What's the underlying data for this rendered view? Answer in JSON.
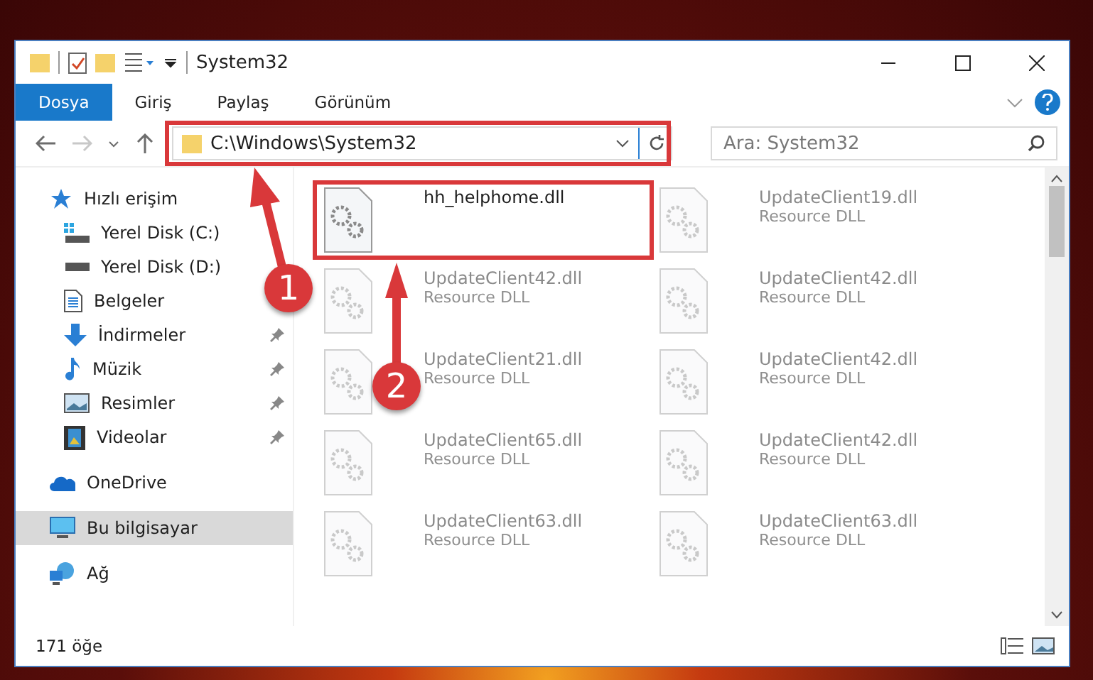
{
  "window": {
    "title": "System32"
  },
  "ribbon_tabs": [
    {
      "label": "Dosya",
      "selected": true
    },
    {
      "label": "Giriş",
      "selected": false
    },
    {
      "label": "Paylaş",
      "selected": false
    },
    {
      "label": "Görünüm",
      "selected": false
    }
  ],
  "address_bar": {
    "value": "C:\\Windows\\System32"
  },
  "search": {
    "placeholder": "Ara: System32"
  },
  "sidebar": {
    "items": [
      {
        "label": "Hızlı erişim",
        "kind": "star",
        "pinned": false,
        "selected": false,
        "children": [
          {
            "label": "Yerel Disk (C:)",
            "kind": "drive-c",
            "pinned": false,
            "selected": false
          },
          {
            "label": "Yerel Disk (D:)",
            "kind": "drive",
            "pinned": false,
            "selected": false
          },
          {
            "label": "Belgeler",
            "kind": "document",
            "pinned": false,
            "selected": false
          },
          {
            "label": "İndirmeler",
            "kind": "download",
            "pinned": true,
            "selected": false
          },
          {
            "label": "Müzik",
            "kind": "music",
            "pinned": true,
            "selected": false
          },
          {
            "label": "Resimler",
            "kind": "picture",
            "pinned": true,
            "selected": false
          },
          {
            "label": "Videolar",
            "kind": "video",
            "pinned": true,
            "selected": false
          }
        ]
      },
      {
        "label": "OneDrive",
        "kind": "cloud",
        "pinned": false,
        "selected": false
      },
      {
        "label": "Bu bilgisayar",
        "kind": "computer",
        "pinned": false,
        "selected": true
      },
      {
        "label": "Ağ",
        "kind": "network",
        "pinned": false,
        "selected": false
      }
    ]
  },
  "files": [
    {
      "name": "hh_helphome.dll",
      "highlighted": true
    },
    {
      "name": "UpdateClient19.dll",
      "type": "Resource DLL",
      "highlighted": false
    },
    {
      "name": "UpdateClient42.dll",
      "type": "Resource DLL",
      "highlighted": false
    },
    {
      "name": "UpdateClient42.dll",
      "type": "Resource DLL",
      "highlighted": false
    },
    {
      "name": "UpdateClient21.dll",
      "type": "Resource DLL",
      "highlighted": false
    },
    {
      "name": "UpdateClient42.dll",
      "type": "Resource DLL",
      "highlighted": false
    },
    {
      "name": "UpdateClient65.dll",
      "type": "Resource DLL",
      "highlighted": false
    },
    {
      "name": "UpdateClient42.dll",
      "type": "Resource DLL",
      "highlighted": false
    },
    {
      "name": "UpdateClient63.dll",
      "type": "Resource DLL",
      "highlighted": false
    },
    {
      "name": "UpdateClient63.dll",
      "type": "Resource DLL",
      "highlighted": false
    }
  ],
  "status_bar": {
    "item_count": "171 öğe"
  },
  "callouts": [
    {
      "number": "1"
    },
    {
      "number": "2"
    }
  ]
}
